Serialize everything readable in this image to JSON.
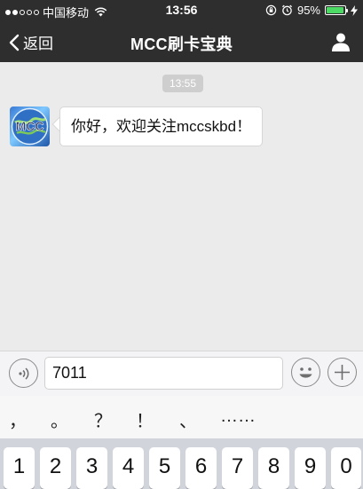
{
  "status_bar": {
    "carrier": "中国移动",
    "time": "13:56",
    "battery": "95%",
    "battery_level": 0.95,
    "icons": [
      "signal-dots-icon",
      "wifi-icon",
      "orientation-lock-icon",
      "alarm-icon",
      "battery-icon",
      "charging-icon"
    ]
  },
  "nav": {
    "back_label": "返回",
    "title": "MCC刷卡宝典",
    "icons": [
      "chevron-left-icon",
      "person-icon"
    ]
  },
  "chat": {
    "timestamp": "13:55",
    "messages": [
      {
        "avatar_text": "MCC",
        "text": "你好，欢迎关注mccskbd！"
      }
    ]
  },
  "input_bar": {
    "value": "7011",
    "icons": [
      "voice-icon",
      "emoji-icon",
      "plus-icon"
    ]
  },
  "candidates": [
    "，",
    "。",
    "？",
    "！",
    "、",
    "……"
  ],
  "keyboard": {
    "keys": [
      "1",
      "2",
      "3",
      "4",
      "5",
      "6",
      "7",
      "8",
      "9",
      "0"
    ]
  },
  "colors": {
    "header_bg": "#2e2e2e",
    "chat_bg": "#ebebeb",
    "battery_fill": "#4cd964",
    "keyboard_bg": "#d1d4da"
  }
}
